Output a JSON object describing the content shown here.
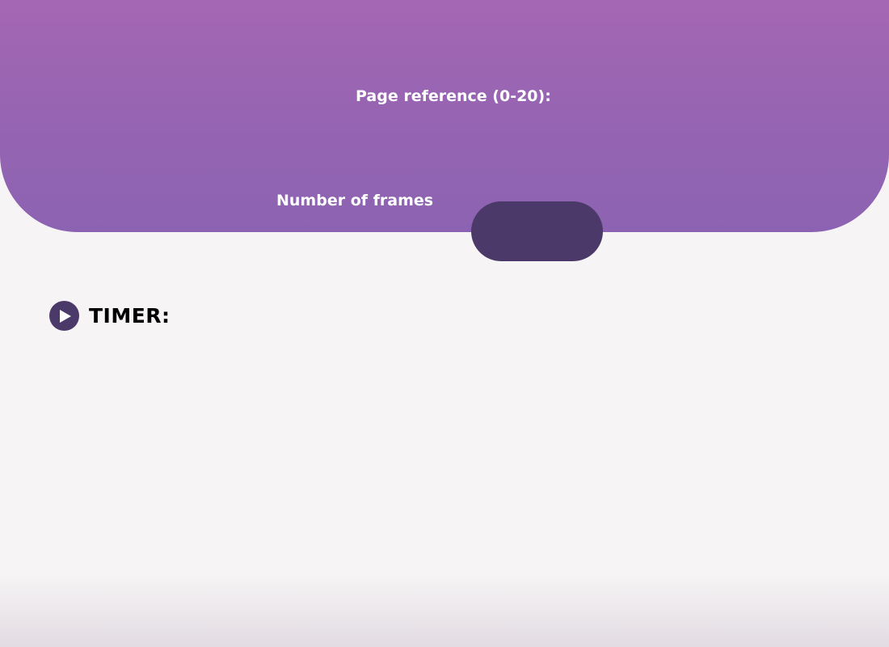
{
  "header": {
    "page_reference_label": "Page reference (0-20):",
    "frames_label": "Number of frames",
    "frames_value": ""
  },
  "timer": {
    "label": "TIMER:",
    "play_icon": "play-icon"
  },
  "colors": {
    "header_gradient_top": "#a467b3",
    "header_gradient_bottom": "#8c63b2",
    "accent_dark": "#4a3969",
    "background": "#f6f4f5"
  }
}
